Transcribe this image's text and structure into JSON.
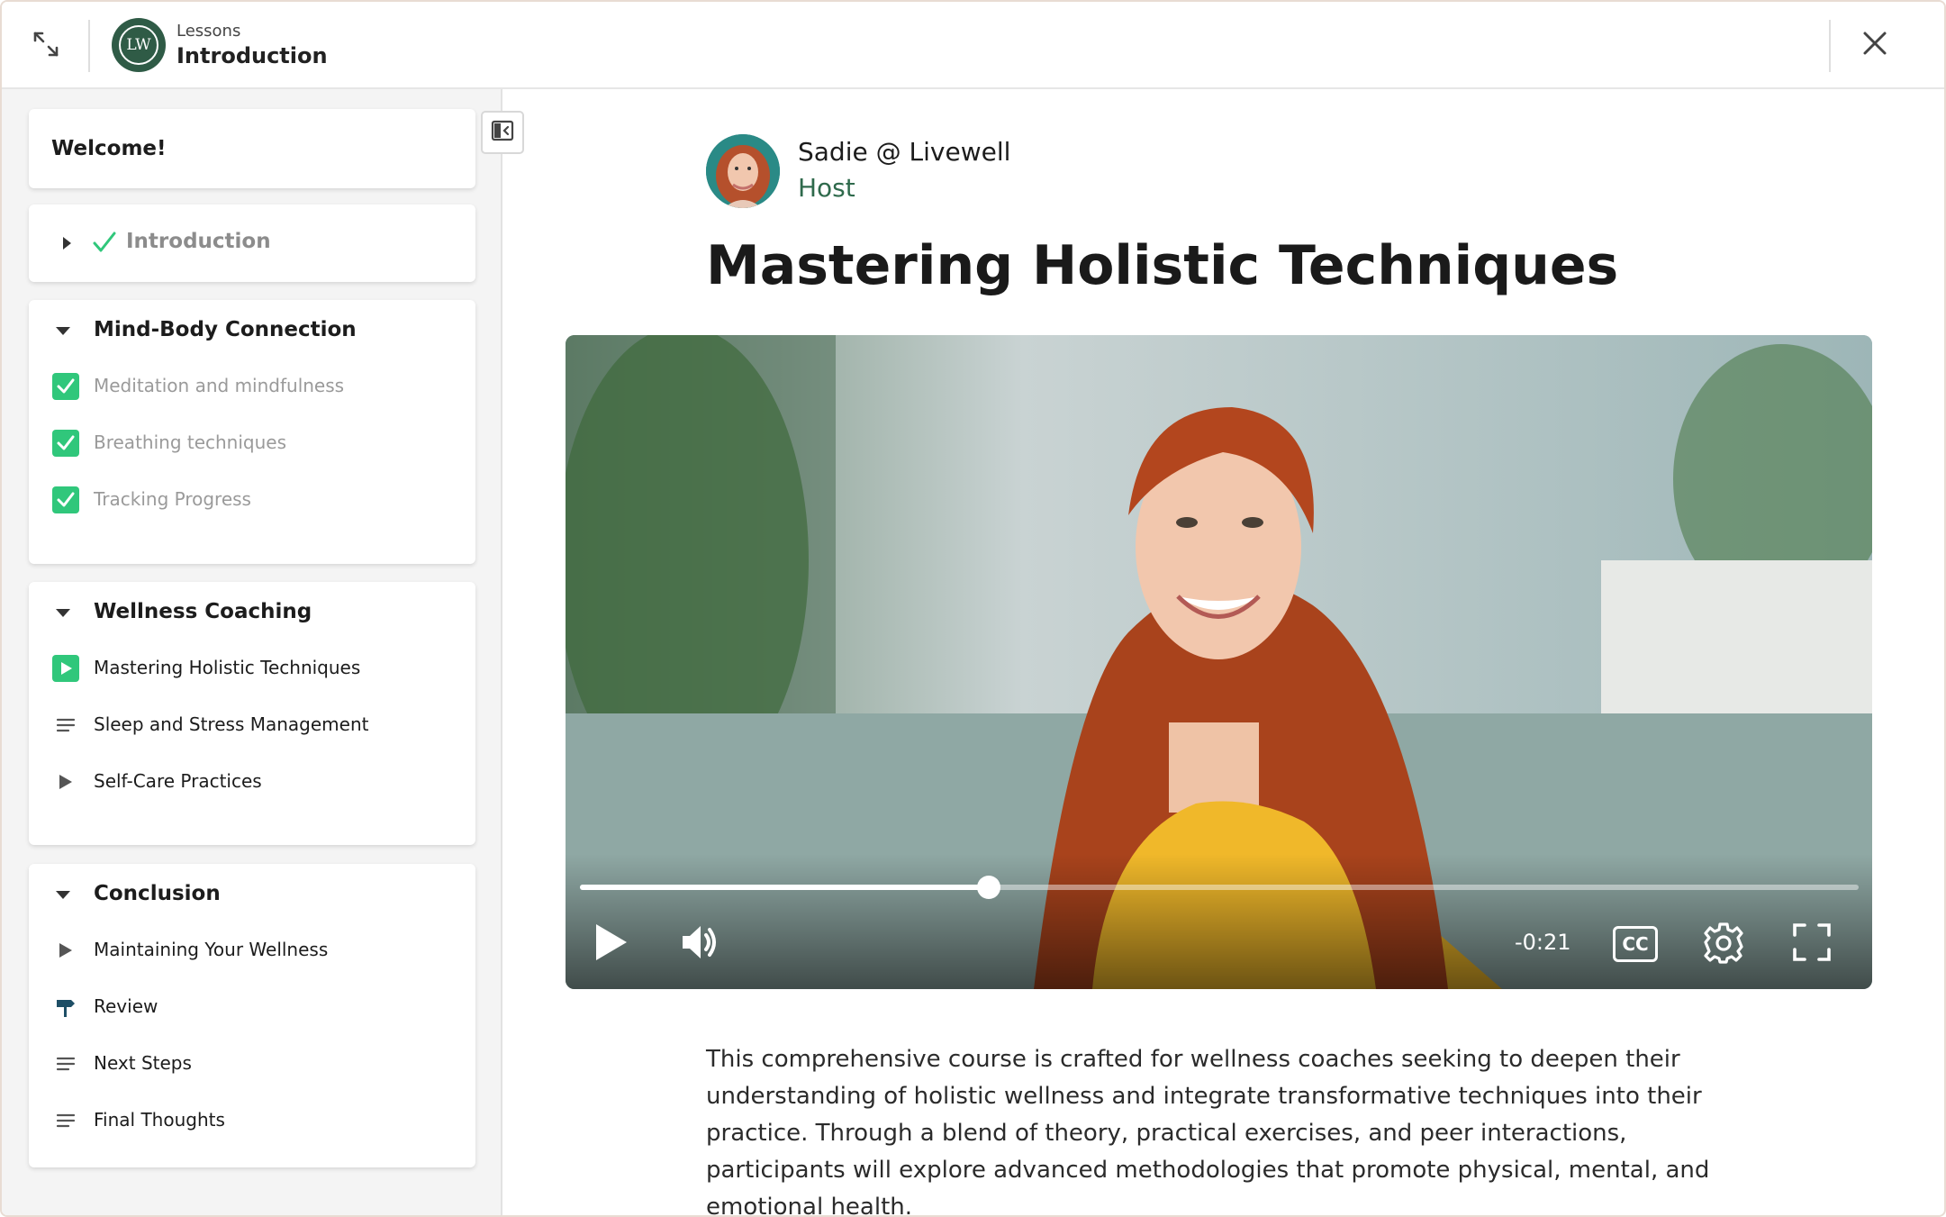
{
  "header": {
    "crumb": "Lessons",
    "title": "Introduction",
    "logo_text": "LW"
  },
  "sidebar": {
    "welcome": "Welcome!",
    "introduction": {
      "title": "Introduction",
      "status": "completed"
    },
    "sections": [
      {
        "title": "Mind-Body Connection",
        "expanded": true,
        "lessons": [
          {
            "label": "Meditation and mindfulness",
            "icon": "check-icon",
            "status": "completed"
          },
          {
            "label": "Breathing techniques",
            "icon": "check-icon",
            "status": "completed"
          },
          {
            "label": "Tracking Progress",
            "icon": "check-icon",
            "status": "completed"
          }
        ]
      },
      {
        "title": "Wellness Coaching",
        "expanded": true,
        "lessons": [
          {
            "label": "Mastering Holistic Techniques",
            "icon": "play-icon",
            "status": "current"
          },
          {
            "label": "Sleep and Stress Management",
            "icon": "text-lines-icon",
            "status": "pending"
          },
          {
            "label": "Self-Care Practices",
            "icon": "play-triangle-icon",
            "status": "pending"
          }
        ]
      },
      {
        "title": "Conclusion",
        "expanded": true,
        "lessons": [
          {
            "label": "Maintaining Your Wellness",
            "icon": "play-triangle-icon",
            "status": "pending"
          },
          {
            "label": "Review",
            "icon": "signpost-icon",
            "status": "pending"
          },
          {
            "label": "Next Steps",
            "icon": "text-lines-icon",
            "status": "pending"
          },
          {
            "label": "Final Thoughts",
            "icon": "text-lines-icon",
            "status": "pending"
          }
        ]
      }
    ]
  },
  "main": {
    "host_name": "Sadie @ Livewell",
    "host_role": "Host",
    "lesson_title": "Mastering Holistic Techniques",
    "video": {
      "time_remaining": "-0:21",
      "progress": 0.32,
      "cc_label": "CC"
    },
    "description": "This comprehensive course is crafted for wellness coaches seeking to deepen their understanding of holistic wellness and integrate transformative techniques into their practice. Through a blend of theory, practical exercises, and peer interactions, participants will explore advanced methodologies that promote physical, mental, and emotional health."
  },
  "colors": {
    "brand": "#2f5b46",
    "check": "#30c77b",
    "host_role": "#2f6a4c"
  }
}
